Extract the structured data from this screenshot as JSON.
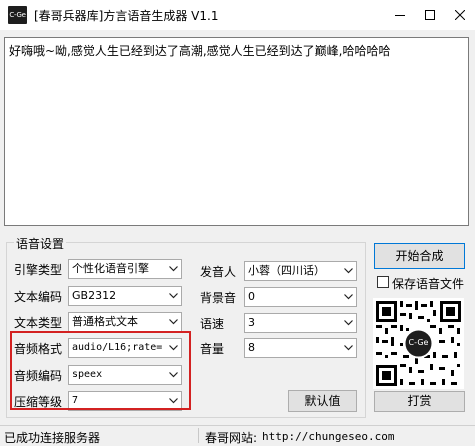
{
  "window": {
    "icon_text": "C-Ge",
    "title": "[春哥兵器库]方言语音生成器 V1.1",
    "controls": [
      "minimize",
      "maximize",
      "close"
    ]
  },
  "main_text": "好嗨哦~呦,感觉人生已经到达了高潮,感觉人生已经到达了巅峰,哈哈哈哈",
  "voice_settings": {
    "group_title": "语音设置",
    "engine_type": {
      "label": "引擎类型",
      "value": "个性化语音引擎"
    },
    "text_encoding": {
      "label": "文本编码",
      "value": "GB2312"
    },
    "text_type": {
      "label": "文本类型",
      "value": "普通格式文本"
    },
    "audio_format": {
      "label": "音频格式",
      "value": "audio/L16;rate="
    },
    "audio_codec": {
      "label": "音频编码",
      "value": "speex"
    },
    "compression_level": {
      "label": "压缩等级",
      "value": "7"
    },
    "speaker": {
      "label": "发音人",
      "value": "小蓉（四川话）"
    },
    "background_sound": {
      "label": "背景音",
      "value": "0"
    },
    "speed": {
      "label": "语速",
      "value": "3"
    },
    "volume": {
      "label": "音量",
      "value": "8"
    },
    "default_button": "默认值"
  },
  "actions": {
    "start_button": "开始合成",
    "save_checkbox_label": "保存语音文件",
    "save_checked": false,
    "qr_center_text": "C-Ge",
    "donate_button": "打赏"
  },
  "status": {
    "message": "已成功连接服务器",
    "website_label": "春哥网站: ",
    "website_url": "http://chungeseo.com"
  },
  "colors": {
    "highlight_box": "#d32121",
    "primary_button_border": "#0078d7"
  }
}
